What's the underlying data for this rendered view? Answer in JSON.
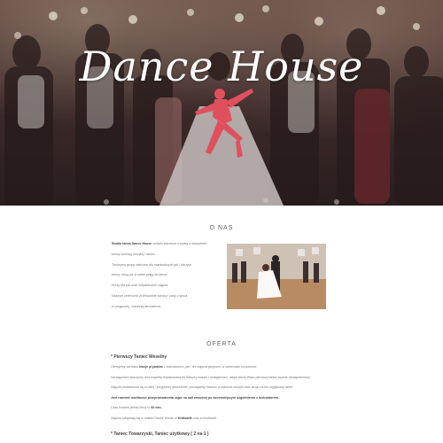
{
  "hero": {
    "title": "Dance House"
  },
  "about": {
    "heading": "O NAS",
    "paragraphs": [
      {
        "bold": "Studio tańca Dance House",
        "rest": " zostało założone z myślą o wszystkich"
      },
      {
        "bold": "",
        "rest": "którzy kochają muzykę i taniec."
      },
      {
        "bold": "",
        "rest": "Tworzymy grupy wiekowe dla najmłodszych jak i dla tych"
      },
      {
        "bold": "",
        "rest": "którzy czują już w sobie pasję do tańca."
      },
      {
        "bold": "",
        "rest": "Kursy dla par oraz indywidualne zajęcia."
      },
      {
        "bold": "",
        "rest": "Naszym celem jest przekazanie wiedzy i pasji z tańca"
      },
      {
        "bold": "",
        "rest": "w przyjaznej, rodzinnej atmosferze."
      }
    ]
  },
  "offer": {
    "heading": "OFERTA",
    "item1_title": "* Pierwszy Taniec Weselny",
    "item1_paragraphs": [
      {
        "pre": "Oferujemy zarówno ",
        "bold": "lekcje prywatne",
        "post": " z instruktorem, jak i też zajęcia grupowe, w zależności od potrzeb."
      },
      {
        "pre": "Na zajęciach tworzymy choreografię dopasowaną do Waszej muzyki i umiejętności, dzięki której Wasz pierwszy taniec będzie niezapomniany.",
        "bold": "",
        "post": ""
      },
      {
        "pre": "Zajęcia prowadzone są w miłej i przyjaznej atmosferze, pomagamy również w doborze muzyki oraz stroju na ten wyjątkowy dzień.",
        "bold": "",
        "post": ""
      },
      {
        "pre": "",
        "bold": "Jest również możliwość przeprowadzenia zajęć na sali weselnej po wcześniejszym uzgodnieniu z instruktorem.",
        "post": ""
      },
      {
        "pre": "Czas trwania jednej lekcji to ",
        "bold": "60 min.",
        "post": ""
      },
      {
        "pre": "Zajęcia odbywają się w salach Dance House w ",
        "bold": "Krakowie",
        "post": " oraz w okolicach."
      }
    ],
    "item2_title": "* Taniec Towarzyski, Taniec użytkowy ( 2 na 1 )"
  }
}
